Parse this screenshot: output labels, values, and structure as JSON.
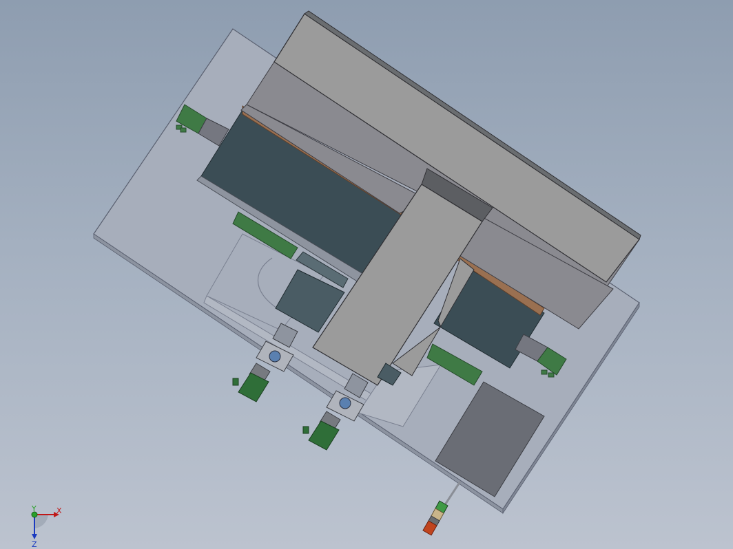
{
  "colors": {
    "background_top": "#8e9db0",
    "background_bottom": "#bcc3cf",
    "base_plate": "#a7aebb",
    "top_block": "#9b9b9b",
    "upper_panel": "#8a8a90",
    "dark_slab": "#3b4d55",
    "copper_strip": "#9a7051",
    "pcb_green": "#3f7a45",
    "motor_green": "#2f6e38",
    "dark_gray_panel": "#6a6d75",
    "triad_x": "#c01818",
    "triad_y": "#2aa02a",
    "triad_z": "#1a3ac0"
  },
  "triad": {
    "x_label": "X",
    "y_label": "Y",
    "z_label": "Z"
  },
  "icons": [
    "coordinate-triad-icon",
    "motor-icon",
    "sensor-icon"
  ]
}
